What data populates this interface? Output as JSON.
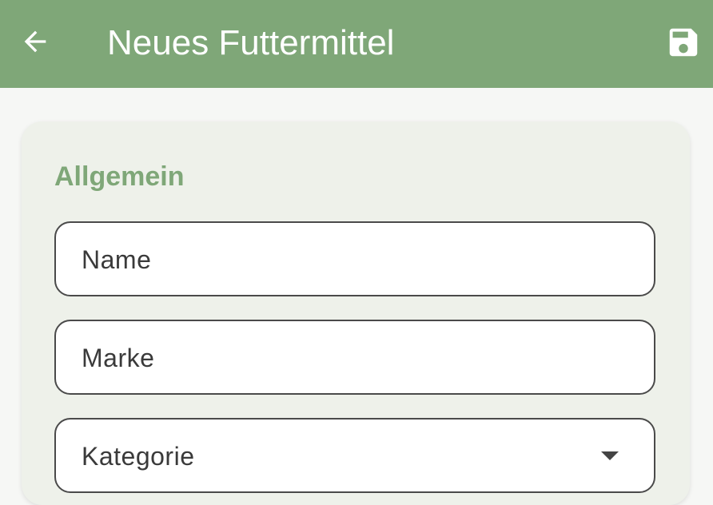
{
  "appbar": {
    "title": "Neues Futtermittel",
    "back_icon": "arrow-back-icon",
    "save_icon": "save-icon"
  },
  "colors": {
    "primary": "#7fa778",
    "card_background": "#eef1ea",
    "page_background": "#f6f7f5"
  },
  "form": {
    "section_title": "Allgemein",
    "fields": {
      "name": {
        "label": "Name"
      },
      "brand": {
        "label": "Marke"
      },
      "category": {
        "label": "Kategorie"
      }
    }
  }
}
